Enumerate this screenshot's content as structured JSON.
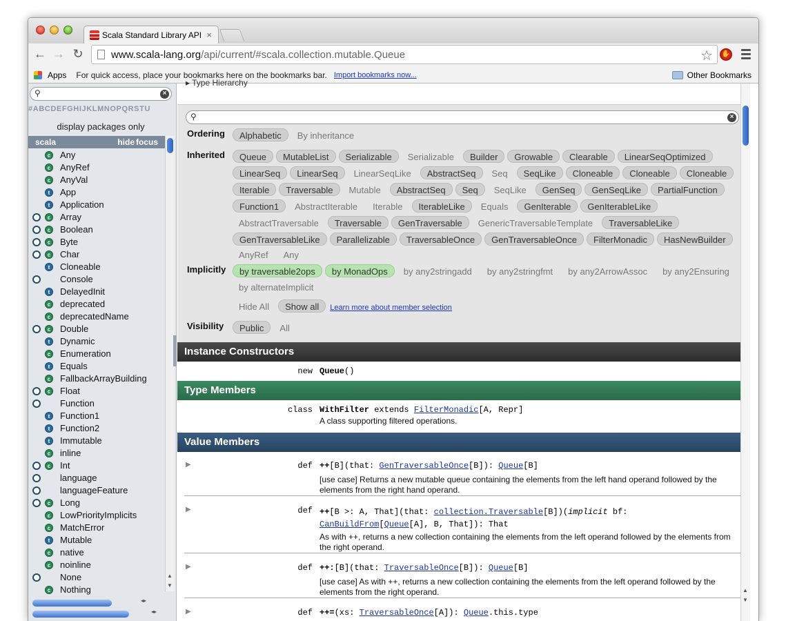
{
  "browser": {
    "tab_title": "Scala Standard Library API",
    "tab_close": "×",
    "url_host": "www.scala-lang.org",
    "url_path": "/api/current/#scala.collection.mutable.Queue",
    "bookmarks_apps": "Apps",
    "bookmarks_hint": "For quick access, place your bookmarks here on the bookmarks bar.",
    "bookmarks_import": "Import bookmarks now...",
    "other_bookmarks": "Other Bookmarks"
  },
  "left": {
    "letters": "#ABCDEFGHIJKLMNOPQRSTU",
    "display_packages": "display packages only",
    "package": "scala",
    "hide": "hide",
    "focus": "focus",
    "items": [
      {
        "name": "Any",
        "o": false,
        "k": "c"
      },
      {
        "name": "AnyRef",
        "o": false,
        "k": "c"
      },
      {
        "name": "AnyVal",
        "o": false,
        "k": "c"
      },
      {
        "name": "App",
        "o": false,
        "k": "t"
      },
      {
        "name": "Application",
        "o": false,
        "k": "t"
      },
      {
        "name": "Array",
        "o": true,
        "k": "c"
      },
      {
        "name": "Boolean",
        "o": true,
        "k": "c"
      },
      {
        "name": "Byte",
        "o": true,
        "k": "c"
      },
      {
        "name": "Char",
        "o": true,
        "k": "c"
      },
      {
        "name": "Cloneable",
        "o": false,
        "k": "t"
      },
      {
        "name": "Console",
        "o": true,
        "k": ""
      },
      {
        "name": "DelayedInit",
        "o": false,
        "k": "t"
      },
      {
        "name": "deprecated",
        "o": false,
        "k": "c"
      },
      {
        "name": "deprecatedName",
        "o": false,
        "k": "c"
      },
      {
        "name": "Double",
        "o": true,
        "k": "c"
      },
      {
        "name": "Dynamic",
        "o": false,
        "k": "t"
      },
      {
        "name": "Enumeration",
        "o": false,
        "k": "c"
      },
      {
        "name": "Equals",
        "o": false,
        "k": "t"
      },
      {
        "name": "FallbackArrayBuilding",
        "o": false,
        "k": "c"
      },
      {
        "name": "Float",
        "o": true,
        "k": "c"
      },
      {
        "name": "Function",
        "o": true,
        "k": ""
      },
      {
        "name": "Function1",
        "o": false,
        "k": "t"
      },
      {
        "name": "Function2",
        "o": false,
        "k": "t"
      },
      {
        "name": "Immutable",
        "o": false,
        "k": "t"
      },
      {
        "name": "inline",
        "o": false,
        "k": "c"
      },
      {
        "name": "Int",
        "o": true,
        "k": "c"
      },
      {
        "name": "language",
        "o": true,
        "k": ""
      },
      {
        "name": "languageFeature",
        "o": true,
        "k": ""
      },
      {
        "name": "Long",
        "o": true,
        "k": "c"
      },
      {
        "name": "LowPriorityImplicits",
        "o": false,
        "k": "c"
      },
      {
        "name": "MatchError",
        "o": false,
        "k": "c"
      },
      {
        "name": "Mutable",
        "o": false,
        "k": "t"
      },
      {
        "name": "native",
        "o": false,
        "k": "c"
      },
      {
        "name": "noinline",
        "o": false,
        "k": "c"
      },
      {
        "name": "None",
        "o": true,
        "k": ""
      },
      {
        "name": "Nothing",
        "o": false,
        "k": "c"
      }
    ]
  },
  "filter": {
    "type_hierarchy": "Type Hierarchy",
    "ordering_label": "Ordering",
    "ordering": [
      {
        "label": "Alphabetic",
        "on": true
      },
      {
        "label": "By inheritance",
        "on": false
      }
    ],
    "inherited_label": "Inherited",
    "inherited": [
      {
        "label": "Queue",
        "on": true
      },
      {
        "label": "MutableList",
        "on": true
      },
      {
        "label": "Serializable",
        "on": true
      },
      {
        "label": "Serializable",
        "on": false
      },
      {
        "label": "Builder",
        "on": true
      },
      {
        "label": "Growable",
        "on": true
      },
      {
        "label": "Clearable",
        "on": true
      },
      {
        "label": "LinearSeqOptimized",
        "on": true
      },
      {
        "label": "LinearSeq",
        "on": true
      },
      {
        "label": "LinearSeq",
        "on": true
      },
      {
        "label": "LinearSeqLike",
        "on": false
      },
      {
        "label": "AbstractSeq",
        "on": true
      },
      {
        "label": "Seq",
        "on": false
      },
      {
        "label": "SeqLike",
        "on": true
      },
      {
        "label": "Cloneable",
        "on": true
      },
      {
        "label": "Cloneable",
        "on": true
      },
      {
        "label": "Cloneable",
        "on": true
      },
      {
        "label": "Iterable",
        "on": true
      },
      {
        "label": "Traversable",
        "on": true
      },
      {
        "label": "Mutable",
        "on": false
      },
      {
        "label": "AbstractSeq",
        "on": true
      },
      {
        "label": "Seq",
        "on": true
      },
      {
        "label": "SeqLike",
        "on": false
      },
      {
        "label": "GenSeq",
        "on": true
      },
      {
        "label": "GenSeqLike",
        "on": true
      },
      {
        "label": "PartialFunction",
        "on": true
      },
      {
        "label": "Function1",
        "on": true
      },
      {
        "label": "AbstractIterable",
        "on": false
      },
      {
        "label": "Iterable",
        "on": false
      },
      {
        "label": "IterableLike",
        "on": true
      },
      {
        "label": "Equals",
        "on": false
      },
      {
        "label": "GenIterable",
        "on": true
      },
      {
        "label": "GenIterableLike",
        "on": true
      },
      {
        "label": "AbstractTraversable",
        "on": false
      },
      {
        "label": "Traversable",
        "on": true
      },
      {
        "label": "GenTraversable",
        "on": true
      },
      {
        "label": "GenericTraversableTemplate",
        "on": false
      },
      {
        "label": "TraversableLike",
        "on": true
      },
      {
        "label": "GenTraversableLike",
        "on": true
      },
      {
        "label": "Parallelizable",
        "on": true
      },
      {
        "label": "TraversableOnce",
        "on": true
      },
      {
        "label": "GenTraversableOnce",
        "on": true
      },
      {
        "label": "FilterMonadic",
        "on": true
      },
      {
        "label": "HasNewBuilder",
        "on": true
      },
      {
        "label": "AnyRef",
        "on": false
      },
      {
        "label": "Any",
        "on": false
      }
    ],
    "implicitly_label": "Implicitly",
    "implicitly": [
      {
        "label": "by traversable2ops",
        "g": true
      },
      {
        "label": "by MonadOps",
        "g": true
      },
      {
        "label": "by any2stringadd",
        "g": false
      },
      {
        "label": "by any2stringfmt",
        "g": false
      },
      {
        "label": "by any2ArrowAssoc",
        "g": false
      },
      {
        "label": "by any2Ensuring",
        "g": false
      },
      {
        "label": "by alternateImplicit",
        "g": false
      }
    ],
    "hide_all": "Hide All",
    "show_all": "Show all",
    "learn_more": "Learn more about member selection",
    "visibility_label": "Visibility",
    "visibility": [
      {
        "label": "Public",
        "on": true
      },
      {
        "label": "All",
        "on": false
      }
    ]
  },
  "sections": {
    "instance_constructors": "Instance Constructors",
    "type_members": "Type Members",
    "value_members": "Value Members"
  },
  "members": {
    "ctor_kw": "new",
    "ctor_name": "Queue",
    "ctor_rest": "()",
    "type_kw": "class",
    "type_name": "WithFilter",
    "type_ext": " extends ",
    "type_link": "FilterMonadic",
    "type_rest": "[A, Repr]",
    "type_desc": "A class supporting filtered operations.",
    "v1": {
      "kw": "def",
      "name": "++",
      "pre": "[B](that: ",
      "link1": "GenTraversableOnce",
      "mid": "[B]): ",
      "link2": "Queue",
      "post": "[B]",
      "desc": "[use case] Returns a new mutable queue containing the elements from the left hand operand followed by the elements from the right hand operand."
    },
    "v2": {
      "kw": "def",
      "name": "++",
      "pre": "[B >: A, That](that: ",
      "link1": "collection.Traversable",
      "mid": "[B])(",
      "imp": "implicit",
      "mid2": " bf: ",
      "link2": "CanBuildFrom",
      "l2a": "[",
      "link3": "Queue",
      "post": "[A], B, That]): That",
      "desc": "As with ++, returns a new collection containing the elements from the left operand followed by the elements from the right operand."
    },
    "v3": {
      "kw": "def",
      "name": "++:",
      "pre": "[B](that: ",
      "link1": "TraversableOnce",
      "mid": "[B]): ",
      "link2": "Queue",
      "post": "[B]",
      "desc": "[use case] As with ++, returns a new collection containing the elements from the left operand followed by the elements from the right operand."
    },
    "v4": {
      "kw": "def",
      "name": "++=",
      "pre": "(xs: ",
      "link1": "TraversableOnce",
      "mid": "[A]): ",
      "link2": "Queue",
      "post": ".this.type"
    }
  }
}
